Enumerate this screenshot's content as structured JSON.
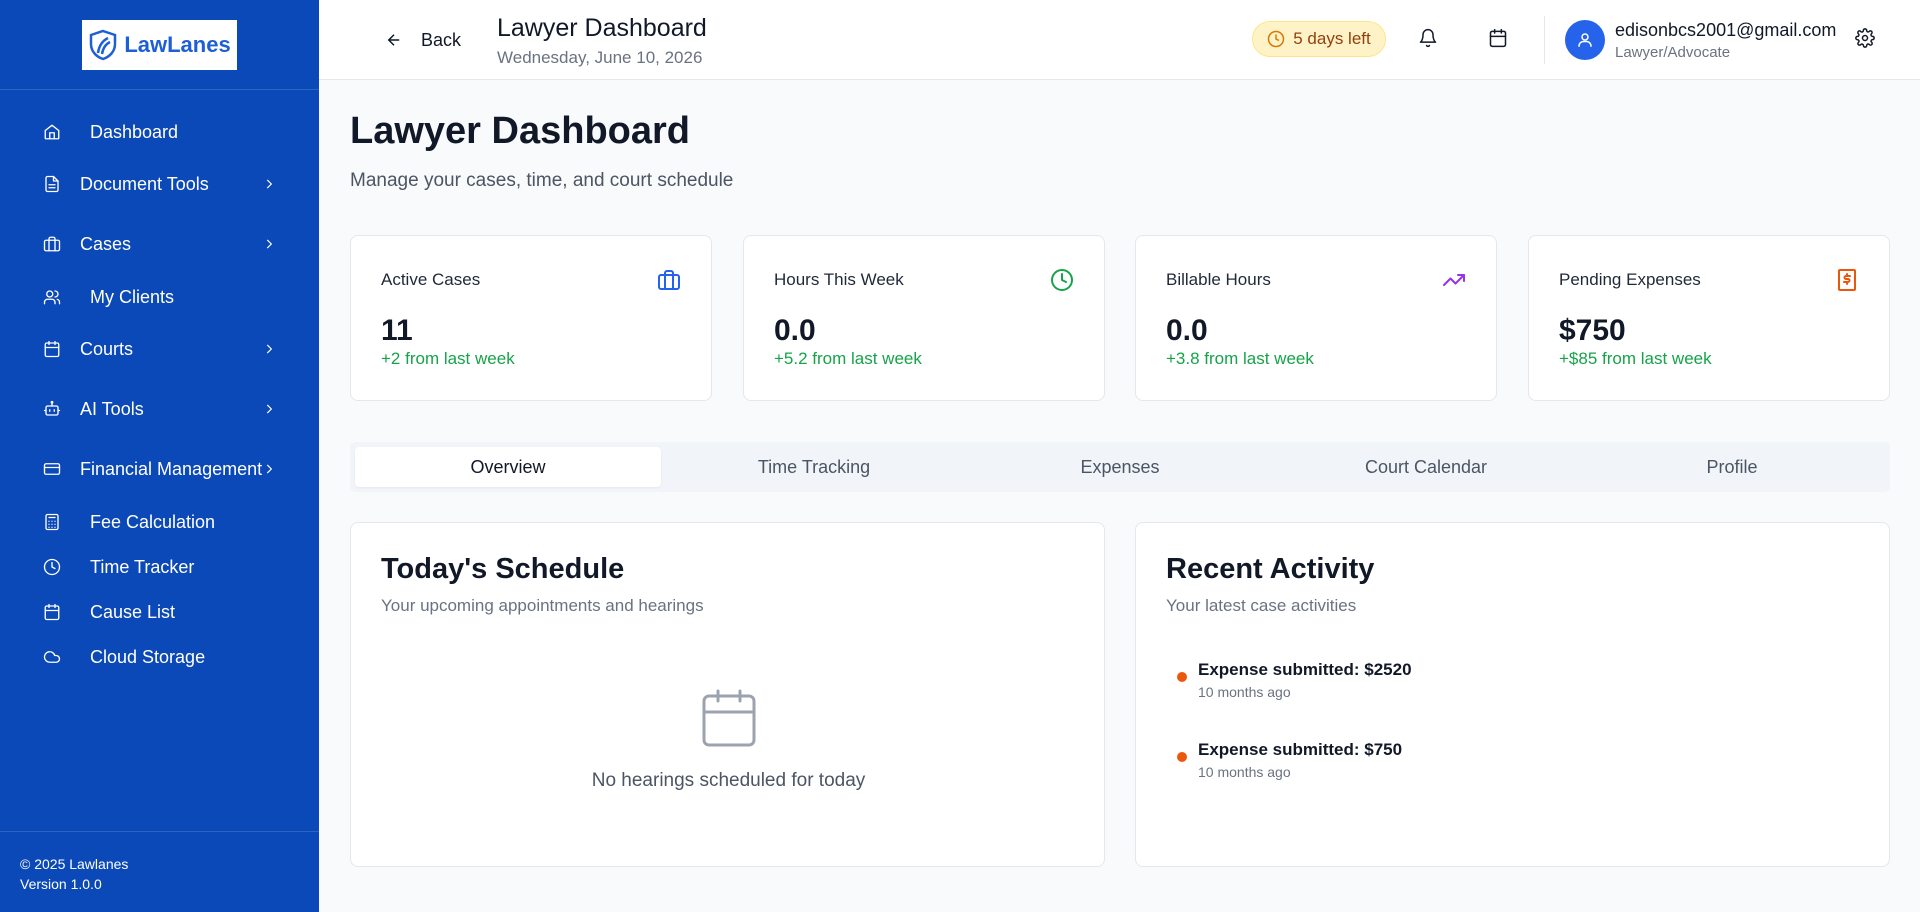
{
  "brand": {
    "name": "LawLanes"
  },
  "sidebar": {
    "items": [
      {
        "label": "Dashboard",
        "icon": "home-icon",
        "expandable": false
      },
      {
        "label": "Document Tools",
        "icon": "file-text-icon",
        "expandable": true
      },
      {
        "label": "Cases",
        "icon": "briefcase-icon",
        "expandable": true
      },
      {
        "label": "My Clients",
        "icon": "users-icon",
        "expandable": false
      },
      {
        "label": "Courts",
        "icon": "calendar-icon",
        "expandable": true
      },
      {
        "label": "AI Tools",
        "icon": "bot-icon",
        "expandable": true
      },
      {
        "label": "Financial Management",
        "icon": "credit-card-icon",
        "expandable": true
      },
      {
        "label": "Fee Calculation",
        "icon": "calculator-icon",
        "expandable": false
      },
      {
        "label": "Time Tracker",
        "icon": "clock-icon",
        "expandable": false
      },
      {
        "label": "Cause List",
        "icon": "calendar-icon",
        "expandable": false
      },
      {
        "label": "Cloud Storage",
        "icon": "cloud-icon",
        "expandable": false
      }
    ],
    "footer": {
      "copyright": "© 2025 Lawlanes",
      "version": "Version 1.0.0"
    }
  },
  "header": {
    "back_label": "Back",
    "title": "Lawyer Dashboard",
    "date": "Wednesday, June 10, 2026",
    "trial_badge": "5 days left",
    "user": {
      "email": "edisonbcs2001@gmail.com",
      "role": "Lawyer/Advocate"
    }
  },
  "main": {
    "title": "Lawyer Dashboard",
    "subtitle": "Manage your cases, time, and court schedule",
    "stats": [
      {
        "label": "Active Cases",
        "value": "11",
        "change": "+2 from last week",
        "icon": "briefcase-icon",
        "color": "#2563eb"
      },
      {
        "label": "Hours This Week",
        "value": "0.0",
        "change": "+5.2 from last week",
        "icon": "clock-icon",
        "color": "#16a34a"
      },
      {
        "label": "Billable Hours",
        "value": "0.0",
        "change": "+3.8 from last week",
        "icon": "trending-up-icon",
        "color": "#9333ea"
      },
      {
        "label": "Pending Expenses",
        "value": "$750",
        "change": "+$85 from last week",
        "icon": "receipt-dollar-icon",
        "color": "#ea580c"
      }
    ],
    "tabs": [
      {
        "label": "Overview",
        "active": true
      },
      {
        "label": "Time Tracking",
        "active": false
      },
      {
        "label": "Expenses",
        "active": false
      },
      {
        "label": "Court Calendar",
        "active": false
      },
      {
        "label": "Profile",
        "active": false
      }
    ],
    "schedule": {
      "title": "Today's Schedule",
      "subtitle": "Your upcoming appointments and hearings",
      "empty_text": "No hearings scheduled for today"
    },
    "activity": {
      "title": "Recent Activity",
      "subtitle": "Your latest case activities",
      "items": [
        {
          "title": "Expense submitted: $2520",
          "time": "10 months ago"
        },
        {
          "title": "Expense submitted: $750",
          "time": "10 months ago"
        }
      ]
    }
  },
  "colors": {
    "sidebar": "#0b48b8",
    "accent": "#2563eb",
    "success": "#16a34a",
    "warning": "#ea580c"
  }
}
